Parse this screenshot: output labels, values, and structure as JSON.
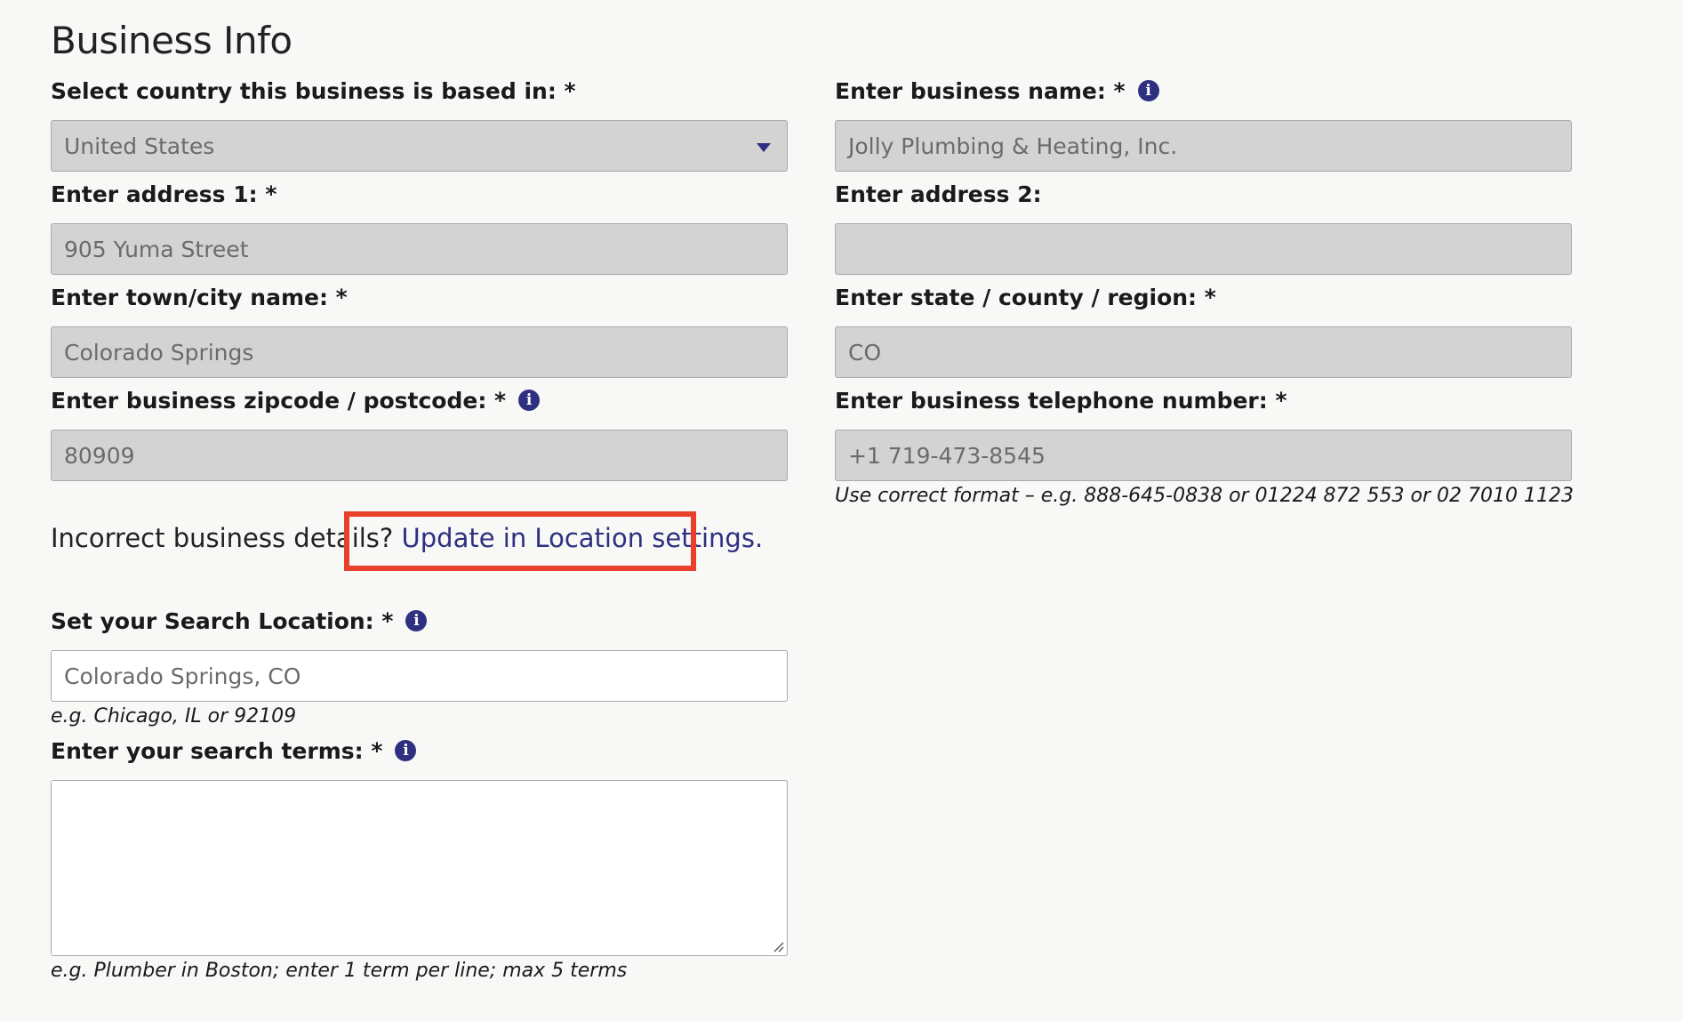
{
  "page": {
    "title": "Business Info"
  },
  "fields": {
    "country": {
      "label": "Select country this business is based in: *",
      "value": "United States"
    },
    "business_name": {
      "label": "Enter business name: *",
      "value": "Jolly Plumbing & Heating, Inc."
    },
    "address1": {
      "label": "Enter address 1: *",
      "value": "905 Yuma Street"
    },
    "address2": {
      "label": "Enter address 2:",
      "value": ""
    },
    "city": {
      "label": "Enter town/city name: *",
      "value": "Colorado Springs"
    },
    "state": {
      "label": "Enter state / county / region: *",
      "value": "CO"
    },
    "zipcode": {
      "label": "Enter business zipcode / postcode: *",
      "value": "80909"
    },
    "telephone": {
      "label": "Enter business telephone number: *",
      "value": "+1 719-473-8545",
      "hint": "Use correct format – e.g. 888-645-0838 or 01224 872 553 or 02 7010 1123"
    },
    "search_location": {
      "label": "Set your Search Location: *",
      "value": "Colorado Springs, CO",
      "hint": "e.g. Chicago, IL or 92109"
    },
    "search_terms": {
      "label": "Enter your search terms: *",
      "value": "",
      "hint": "e.g. Plumber in Boston; enter 1 term per line; max 5 terms"
    }
  },
  "notice": {
    "prefix": "Incorrect business details? ",
    "link_text": "Update in Location settings."
  },
  "icons": {
    "info": "i"
  },
  "colors": {
    "accent": "#2e3080",
    "highlight": "#e8402b",
    "disabled_field": "#d3d3d3",
    "background": "#f8f8f7"
  }
}
